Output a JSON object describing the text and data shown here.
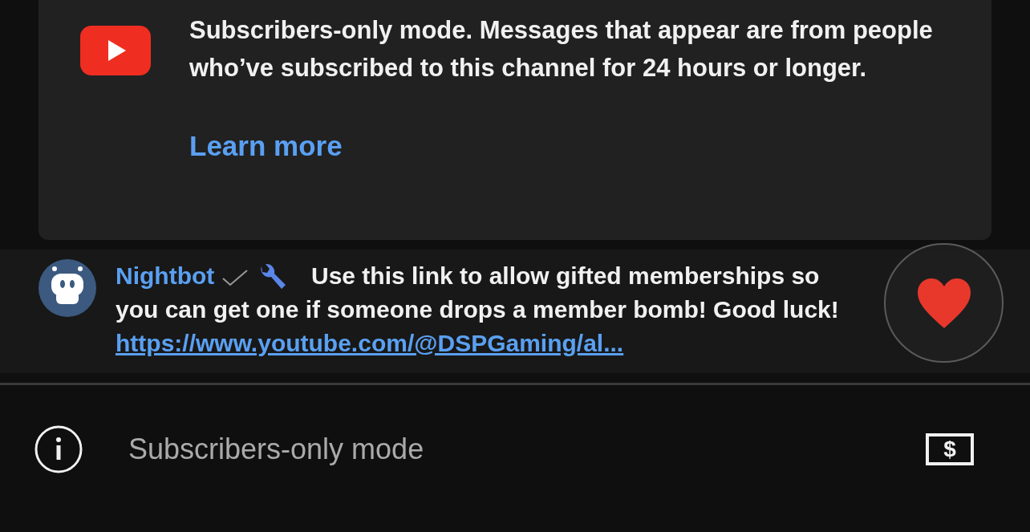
{
  "notice": {
    "text": "Subscribers-only mode. Messages that appear are from people who’ve subscribed to this channel for 24 hours or longer.",
    "link": "Learn more"
  },
  "message": {
    "author": "Nightbot",
    "verified": true,
    "moderator": true,
    "text": "Use this link to allow gifted memberships so you can get one if someone drops a member bomb! Good luck!",
    "link": "https://www.youtube.com/@DSPGaming/al..."
  },
  "input": {
    "placeholder": "Subscribers-only mode"
  },
  "super_chat_button": {
    "symbol": "$"
  }
}
